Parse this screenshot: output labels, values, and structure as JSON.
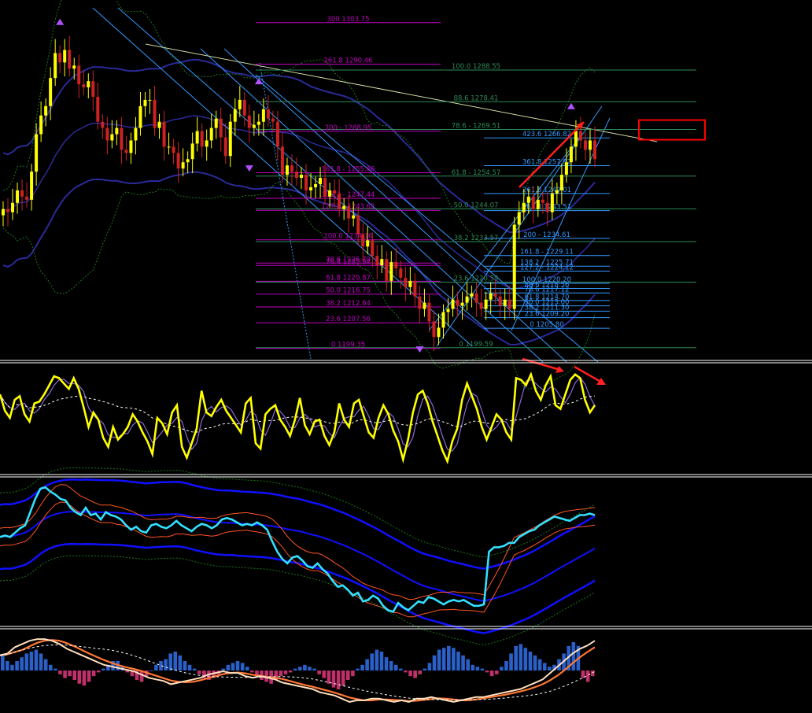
{
  "colors": {
    "background": "#000000",
    "separator": "#ffffff",
    "candle_up": "#ffff00",
    "candle_down": "#cc2222",
    "fib_left": "#c000c0",
    "fib_mid": "#3399ff",
    "fib_right": "#2e8b57",
    "channel": "#3399ff",
    "trendline": "#d0d8a0",
    "bollinger_outer": "#2a2a9a",
    "bollinger_dotted": "#1a7a1a",
    "highlight_box": "#ff0000",
    "arrow": "#ff2020",
    "rsi_line": "#ffff00",
    "rsi_sig": "#8a6ad8",
    "cyan_line": "#33e0ff",
    "blue_band": "#1010ff",
    "orange_line": "#ff5522",
    "macd_pos": "#2a60c8",
    "macd_neg": "#c0306a",
    "macd_line": "#ffe0c0",
    "macd_sig": "#ff7733"
  },
  "icons": [
    "fractal-arrow-icon"
  ],
  "chart_data": [
    {
      "type": "candlestick",
      "panel": "main",
      "fib_levels_left": [
        {
          "label": "300 1303.75"
        },
        {
          "label": "261.8 1290.46"
        },
        {
          "label": "200 - 1268.95"
        },
        {
          "label": "161.8 - 1255.66"
        },
        {
          "label": "138.2 - 1247.44"
        },
        {
          "label": "127.2 - 1243.62"
        },
        {
          "label": "100.0 1234.16"
        },
        {
          "label": "78.6 1226.70"
        },
        {
          "label": "76.4 1225.94"
        },
        {
          "label": "61.8 1220.87"
        },
        {
          "label": "50.0 1216.75"
        },
        {
          "label": "38.2 1212.64"
        },
        {
          "label": "23.6 1207.56"
        },
        {
          "label": "0 1199.35"
        }
      ],
      "fib_levels_mid": [
        {
          "label": "423.6 1266.82"
        },
        {
          "label": "361.8 1257.92"
        },
        {
          "label": "261.8 1249.01"
        },
        {
          "label": "261.8 1243.51"
        },
        {
          "label": "200 - 1234.61"
        },
        {
          "label": "161.8 - 1229.11"
        },
        {
          "label": "138.2 - 1225.71"
        },
        {
          "label": "127.2 - 1224.12"
        },
        {
          "label": "100.0 1220.20"
        },
        {
          "label": "88.6 1218.56"
        },
        {
          "label": "78.6 1217.12"
        },
        {
          "label": "61.8 1214.70"
        },
        {
          "label": "50.0 1213.00"
        },
        {
          "label": "38.2 1211.30"
        },
        {
          "label": "23.6 1209.20"
        },
        {
          "label": "0 1205.80"
        }
      ],
      "fib_levels_right": [
        {
          "label": "100.0 1288.55"
        },
        {
          "label": "88.6 1278.41"
        },
        {
          "label": "78.6 - 1269.51",
          "highlight": true
        },
        {
          "label": "61.8 - 1254.57"
        },
        {
          "label": "50.0 1244.07"
        },
        {
          "label": "38.2 1233.57"
        },
        {
          "label": "23.6 1220.59"
        },
        {
          "label": "0 1199.59"
        }
      ],
      "ylim": [
        1196,
        1310
      ],
      "close": [
        1244,
        1243,
        1246,
        1250,
        1248,
        1247,
        1256,
        1268,
        1274,
        1277,
        1286,
        1294,
        1291,
        1295,
        1289,
        1290,
        1284,
        1283,
        1285,
        1280,
        1272,
        1270,
        1266,
        1268,
        1270,
        1263,
        1262,
        1266,
        1270,
        1277,
        1279,
        1279,
        1270,
        1272,
        1264,
        1264,
        1262,
        1257,
        1259,
        1260,
        1265,
        1269,
        1264,
        1266,
        1270,
        1273,
        1267,
        1261,
        1272,
        1276,
        1279,
        1274,
        1270,
        1271,
        1272,
        1276,
        1273,
        1272,
        1264,
        1255,
        1258,
        1256,
        1254,
        1255,
        1250,
        1251,
        1252,
        1254,
        1248,
        1250,
        1249,
        1244,
        1245,
        1241,
        1242,
        1236,
        1232,
        1234,
        1229,
        1226,
        1228,
        1221,
        1227,
        1225,
        1222,
        1219,
        1221,
        1216,
        1212,
        1214,
        1208,
        1203,
        1206,
        1211,
        1212,
        1215,
        1213,
        1214,
        1216,
        1217,
        1214,
        1212,
        1215,
        1217,
        1216,
        1213,
        1215,
        1212,
        1239,
        1243,
        1246,
        1248,
        1244,
        1247,
        1246,
        1243,
        1249,
        1250,
        1255,
        1259,
        1264,
        1269,
        1266,
        1263,
        1266,
        1260
      ]
    },
    {
      "type": "line",
      "panel": "rsi-oscillator",
      "series": [
        {
          "values": [
            58,
            49,
            45,
            55,
            57,
            47,
            43,
            53,
            54,
            58,
            63,
            68,
            67,
            64,
            61,
            67,
            61,
            51,
            40,
            48,
            44,
            34,
            29,
            40,
            33,
            36,
            40,
            47,
            43,
            37,
            32,
            25,
            45,
            42,
            36,
            48,
            52,
            29,
            23,
            31,
            39,
            60,
            48,
            46,
            51,
            55,
            49,
            45,
            41,
            37,
            53,
            56,
            31,
            28,
            47,
            50,
            52,
            44,
            40,
            35,
            44,
            56,
            41,
            36,
            43,
            44,
            35,
            30,
            37,
            53,
            44,
            40,
            53,
            55,
            46,
            37,
            34,
            45,
            52,
            47,
            38,
            32,
            22,
            33,
            48,
            58,
            60,
            53,
            43,
            35,
            27,
            21,
            32,
            39,
            55,
            64,
            57,
            50,
            40,
            33,
            40,
            47,
            44,
            37,
            33,
            67,
            66,
            63,
            69,
            60,
            55,
            63,
            68,
            52,
            50,
            58,
            66,
            69,
            67,
            55,
            48,
            52
          ]
        }
      ]
    },
    {
      "type": "line",
      "panel": "cyan-oscillator",
      "series": [
        {
          "values": [
            60,
            61,
            60,
            63,
            66,
            68,
            77,
            86,
            93,
            94,
            91,
            89,
            86,
            85,
            80,
            77,
            75,
            80,
            75,
            76,
            72,
            77,
            75,
            74,
            72,
            68,
            65,
            67,
            64,
            63,
            68,
            69,
            67,
            66,
            68,
            71,
            68,
            66,
            64,
            67,
            69,
            68,
            66,
            68,
            72,
            73,
            72,
            70,
            68,
            69,
            68,
            70,
            68,
            65,
            57,
            50,
            45,
            42,
            46,
            47,
            44,
            40,
            39,
            42,
            38,
            35,
            30,
            26,
            27,
            24,
            20,
            22,
            16,
            17,
            20,
            18,
            13,
            10,
            9,
            15,
            12,
            10,
            13,
            16,
            15,
            19,
            18,
            16,
            14,
            16,
            17,
            16,
            17,
            15,
            13,
            13,
            14,
            50,
            53,
            53,
            54,
            56,
            56,
            60,
            62,
            64,
            65,
            68,
            70,
            72,
            74,
            73,
            72,
            71,
            73,
            75,
            75,
            76,
            75
          ]
        }
      ]
    },
    {
      "type": "bar+line",
      "panel": "macd-histogram",
      "histogram": [
        0.8,
        0.5,
        0.3,
        0.5,
        0.7,
        0.9,
        1.0,
        1.1,
        0.9,
        0.6,
        0.3,
        0.1,
        -0.2,
        -0.4,
        -0.3,
        -0.5,
        -0.7,
        -0.8,
        -0.6,
        -0.3,
        -0.1,
        0.1,
        0.3,
        0.5,
        0.5,
        0.2,
        -0.1,
        -0.3,
        -0.5,
        -0.6,
        -0.3,
        0.0,
        0.3,
        0.5,
        0.6,
        0.9,
        1.0,
        0.8,
        0.5,
        0.3,
        0.1,
        -0.2,
        -0.4,
        -0.5,
        -0.4,
        -0.2,
        0.1,
        0.3,
        0.4,
        0.5,
        0.4,
        0.2,
        -0.1,
        -0.3,
        -0.5,
        -0.6,
        -0.7,
        -0.5,
        -0.3,
        -0.2,
        -0.1,
        0.1,
        0.2,
        0.3,
        0.2,
        0.1,
        -0.2,
        -0.4,
        -0.7,
        -0.9,
        -1.0,
        -0.8,
        -0.5,
        -0.3,
        0.1,
        0.3,
        0.6,
        0.9,
        1.1,
        1.0,
        0.7,
        0.5,
        0.3,
        0.1,
        -0.1,
        -0.3,
        -0.4,
        -0.2,
        0.1,
        0.4,
        0.8,
        1.1,
        1.2,
        1.3,
        1.2,
        1.0,
        0.8,
        0.6,
        0.3,
        0.2,
        0.1,
        -0.1,
        -0.3,
        -0.2,
        0.2,
        0.5,
        0.9,
        1.3,
        1.4,
        1.2,
        1.0,
        0.8,
        0.6,
        0.4,
        0.2,
        0.3,
        0.6,
        0.9,
        1.3,
        1.5,
        1.3,
        -0.4,
        -0.6,
        -0.3
      ],
      "series": [
        {
          "values": [
            0.9,
            1.0,
            1.4,
            1.6,
            1.8,
            1.9,
            1.9,
            1.8,
            1.6,
            1.3,
            1.1,
            0.9,
            0.7,
            0.5,
            0.3,
            0.2,
            0.1,
            0.0,
            -0.1,
            -0.3,
            -0.5,
            -0.6,
            -0.7,
            -0.9,
            -0.8,
            -0.7,
            -0.6,
            -0.5,
            -0.3,
            -0.2,
            -0.1,
            -0.2,
            -0.2,
            -0.4,
            -0.5,
            -0.4,
            -0.5,
            -0.6,
            -0.8,
            -0.9,
            -1.0,
            -1.1,
            -1.2,
            -1.4,
            -1.5,
            -1.6,
            -1.8,
            -2.0,
            -1.9,
            -1.9,
            -1.8,
            -1.8,
            -1.9,
            -2.0,
            -1.9,
            -2.0,
            -1.8,
            -1.8,
            -1.7,
            -1.8,
            -1.9,
            -2.0,
            -1.9,
            -1.8,
            -1.7,
            -1.7,
            -1.6,
            -1.5,
            -1.4,
            -1.3,
            -1.2,
            -1.0,
            -0.8,
            -0.6,
            -0.2,
            0.2,
            0.6,
            1.0,
            1.3,
            1.5,
            1.8
          ]
        }
      ]
    }
  ]
}
